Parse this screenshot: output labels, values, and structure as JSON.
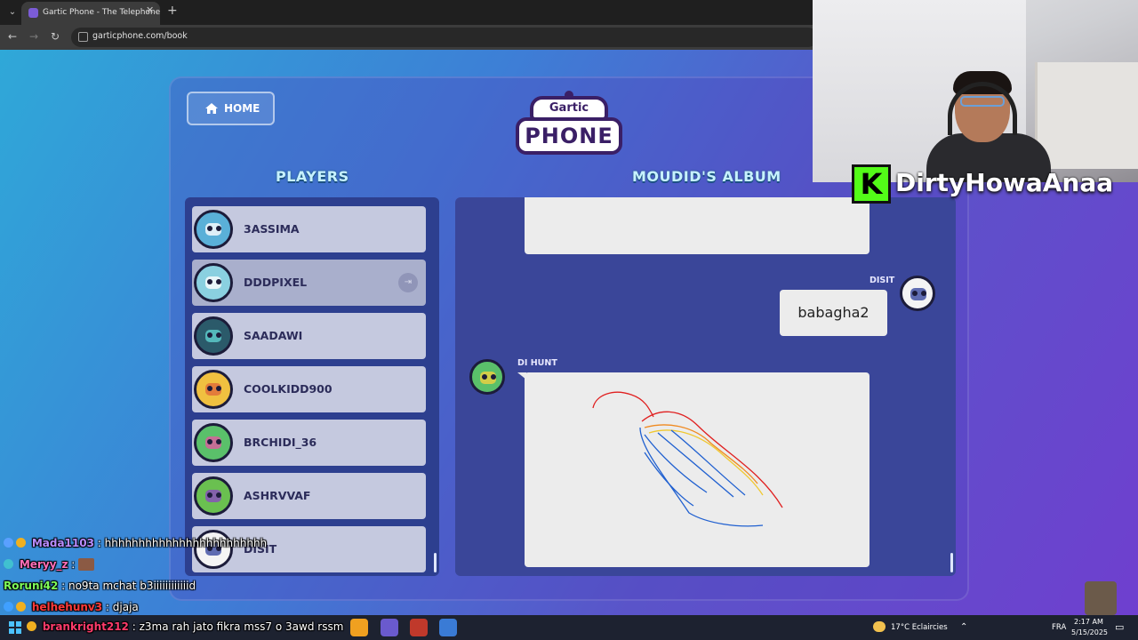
{
  "browser": {
    "tab_title": "Gartic Phone - The Telephone G",
    "url": "garticphone.com/book"
  },
  "game": {
    "home_label": "HOME",
    "logo_top": "Gartic",
    "logo_main": "PHONE",
    "players_title": "PLAYERS",
    "album_title": "MOUDID'S ALBUM",
    "players": [
      {
        "name": "3ASSIMA",
        "color": "#5ab0d8"
      },
      {
        "name": "DDDPIXEL",
        "color": "#8ad0e0"
      },
      {
        "name": "SAADAWI",
        "color": "#2b5a6a"
      },
      {
        "name": "COOLKIDD900",
        "color": "#f0c040"
      },
      {
        "name": "BRCHIDI_36",
        "color": "#5ac06a"
      },
      {
        "name": "ASHRVVAF",
        "color": "#6ac050"
      },
      {
        "name": "DISIT",
        "color": "#ffffff"
      }
    ],
    "album": {
      "guess_author": "DISIT",
      "guess_text": "babagha2",
      "drawing_author": "DI HUNT"
    }
  },
  "stream": {
    "kick_icon": "kick-logo",
    "channel_name": "DirtyHowaAnaa"
  },
  "chat": [
    {
      "user": "Mada1103",
      "user_color": "#b98cff",
      "text": " : hhhhhhhhhhhhhhhhhhhhhhhh"
    },
    {
      "user": "Meryy_z",
      "user_color": "#ff6fb8",
      "text": " : "
    },
    {
      "user": "Roruni42",
      "user_color": "#7fff5a",
      "text": " : no9ta mchat b3iiiiiiiiiiiid"
    },
    {
      "user": "helhehunv3",
      "user_color": "#ff3b3b",
      "text": " : djaja"
    },
    {
      "user": "brankright212",
      "user_color": "#ff3b6b",
      "text": " : z3ma rah jato fikra mss7 o 3awd rssm"
    }
  ],
  "taskbar": {
    "weather": "17°C  Eclaircies",
    "lang": "FRA",
    "time": "2:17 AM",
    "date": "5/15/2025"
  }
}
